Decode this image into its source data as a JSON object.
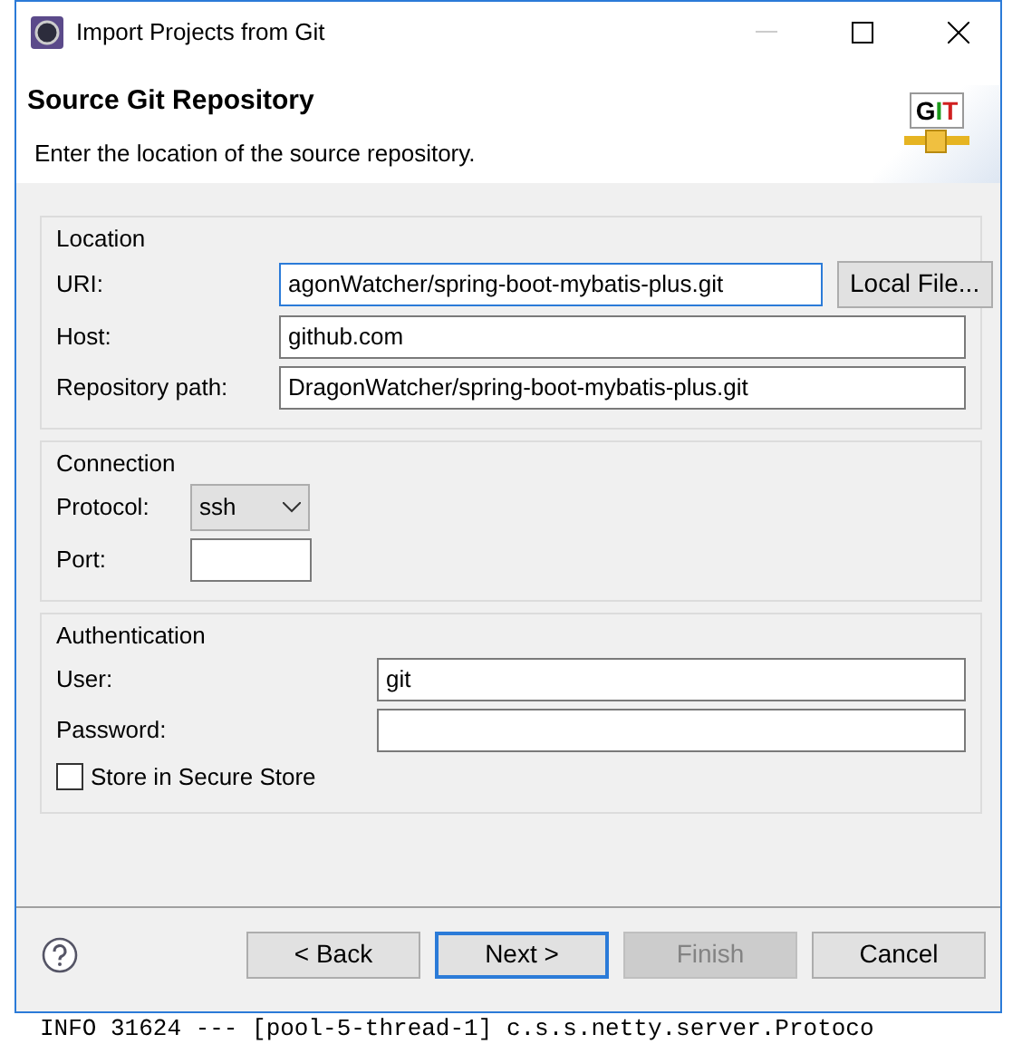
{
  "window": {
    "title": "Import Projects from Git"
  },
  "header": {
    "title": "Source Git Repository",
    "description": "Enter the location of the source repository.",
    "logo_text": "GIT"
  },
  "groups": [
    {
      "title": "Location",
      "fields": [
        {
          "kind": "text",
          "label": "URI:",
          "value": "agonWatcher/spring-boot-mybatis-plus.git",
          "focused": true,
          "button": "Local File..."
        },
        {
          "kind": "text",
          "label": "Host:",
          "value": "github.com",
          "focused": false
        },
        {
          "kind": "text",
          "label": "Repository path:",
          "value": "DragonWatcher/spring-boot-mybatis-plus.git",
          "focused": false
        }
      ]
    },
    {
      "title": "Connection",
      "fields": [
        {
          "kind": "select",
          "label": "Protocol:",
          "value": "ssh"
        },
        {
          "kind": "short",
          "label": "Port:"
        }
      ]
    },
    {
      "title": "Authentication",
      "fields": [
        {
          "kind": "text",
          "label": "User:",
          "value": "git",
          "focused": false
        },
        {
          "kind": "password",
          "label": "Password:",
          "focused": false
        },
        {
          "kind": "checkbox",
          "label": "Store in Secure Store",
          "checked": false
        }
      ]
    }
  ],
  "buttons": [
    {
      "label": "< Back",
      "default": false,
      "disabled": false
    },
    {
      "label": "Next >",
      "default": true,
      "disabled": false
    },
    {
      "label": "Finish",
      "default": false,
      "disabled": true
    },
    {
      "label": "Cancel",
      "default": false,
      "disabled": false
    }
  ],
  "background": {
    "log_line": "INFO 31624 --- [pool-5-thread-1] c.s.s.netty.server.Protoco"
  }
}
